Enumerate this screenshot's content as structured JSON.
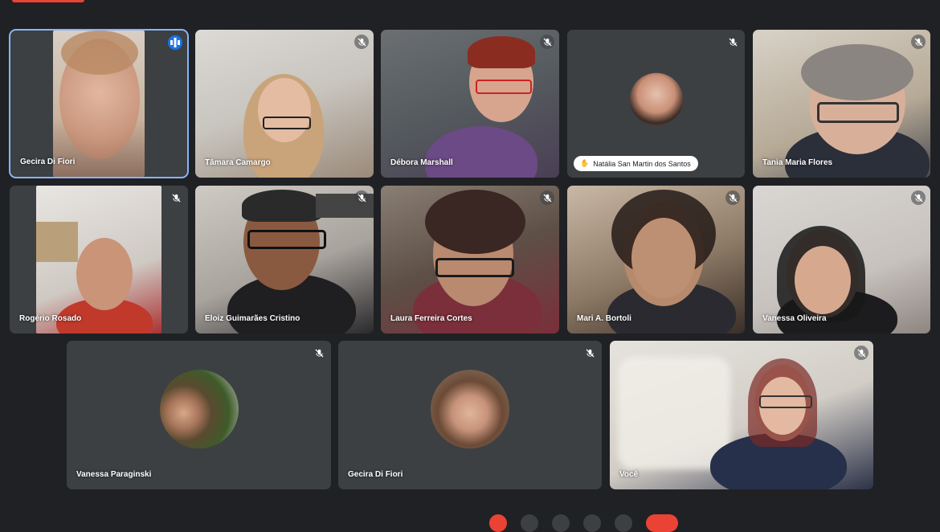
{
  "participants": [
    {
      "name": "Gecira Di Fiori",
      "status": "speaking"
    },
    {
      "name": "Tâmara Camargo",
      "status": "muted"
    },
    {
      "name": "Débora Marshall",
      "status": "muted"
    },
    {
      "name": "Natália San Martin dos Santos",
      "status": "muted",
      "hand_raised": true
    },
    {
      "name": "Tania Maria Flores",
      "status": "muted"
    },
    {
      "name": "Rogério Rosado",
      "status": "muted"
    },
    {
      "name": "Eloiz Guimarães Cristino",
      "status": "muted"
    },
    {
      "name": "Laura Ferreira Cortes",
      "status": "muted"
    },
    {
      "name": "Mari A. Bortoli",
      "status": "muted"
    },
    {
      "name": "Vanessa Oliveira",
      "status": "muted"
    },
    {
      "name": "Vanessa Paraginski",
      "status": "muted"
    },
    {
      "name": "Gecira Di Fiori",
      "status": "muted"
    },
    {
      "name": "Você",
      "status": "muted"
    }
  ],
  "icons": {
    "mic_off": "mic-off-icon",
    "speaking": "audio-levels-icon",
    "hand": "raised-hand-icon"
  },
  "colors": {
    "background": "#202124",
    "tile": "#3c4043",
    "active_border": "#8ab4f8",
    "speaking_badge": "#1a73e8",
    "end_call": "#ea4335"
  }
}
